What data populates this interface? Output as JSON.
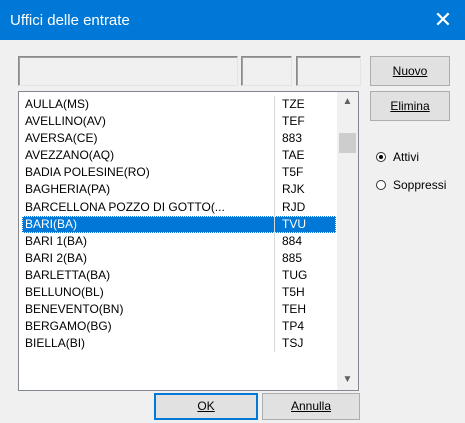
{
  "window": {
    "title": "Uffici delle entrate",
    "close_glyph": "✕"
  },
  "buttons": {
    "nuovo": "Nuovo",
    "elimina": "Elimina",
    "ok": "OK",
    "annulla": "Annulla"
  },
  "fields": {
    "name": "",
    "code1": "",
    "code2": ""
  },
  "radios": {
    "attivi": {
      "label": "Attivi",
      "selected": true
    },
    "soppressi": {
      "label": "Soppressi",
      "selected": false
    }
  },
  "list": {
    "selected_index": 7,
    "rows": [
      {
        "name": "AULLA(MS)",
        "code": "TZE"
      },
      {
        "name": "AVELLINO(AV)",
        "code": "TEF"
      },
      {
        "name": "AVERSA(CE)",
        "code": "883"
      },
      {
        "name": "AVEZZANO(AQ)",
        "code": "TAE"
      },
      {
        "name": "BADIA POLESINE(RO)",
        "code": "T5F"
      },
      {
        "name": "BAGHERIA(PA)",
        "code": "RJK"
      },
      {
        "name": "BARCELLONA POZZO DI GOTTO(...",
        "code": "RJD"
      },
      {
        "name": "BARI(BA)",
        "code": "TVU"
      },
      {
        "name": "BARI 1(BA)",
        "code": "884"
      },
      {
        "name": "BARI 2(BA)",
        "code": "885"
      },
      {
        "name": "BARLETTA(BA)",
        "code": "TUG"
      },
      {
        "name": "BELLUNO(BL)",
        "code": "T5H"
      },
      {
        "name": "BENEVENTO(BN)",
        "code": "TEH"
      },
      {
        "name": "BERGAMO(BG)",
        "code": "TP4"
      },
      {
        "name": "BIELLA(BI)",
        "code": "TSJ"
      }
    ]
  },
  "colors": {
    "accent": "#0078d7",
    "background": "#f0f0f0"
  }
}
